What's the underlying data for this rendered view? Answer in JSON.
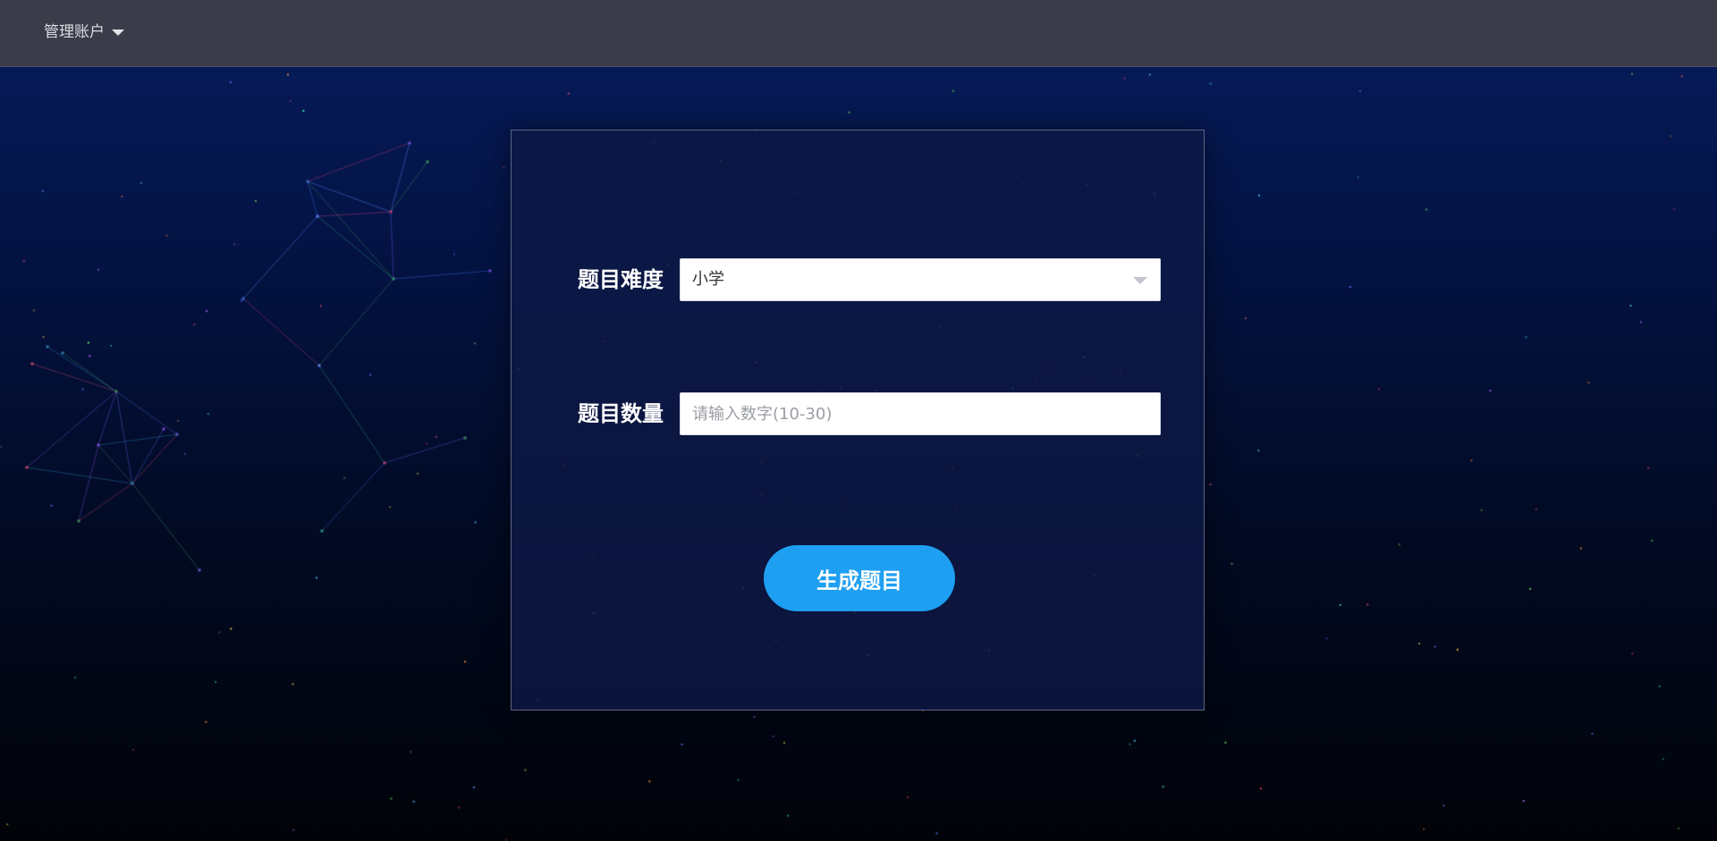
{
  "header": {
    "account_menu_label": "管理账户",
    "account_menu_icon": "caret-down-icon"
  },
  "form": {
    "difficulty": {
      "label": "题目难度",
      "selected_value": "小学",
      "dropdown_icon": "caret-down-icon"
    },
    "count": {
      "label": "题目数量",
      "value": "",
      "placeholder": "请输入数字(10-30)"
    },
    "submit_label": "生成题目"
  },
  "colors": {
    "topbar": "#3a3d49",
    "background_top": "#061a57",
    "background_bottom": "#010308",
    "panel_border": "#5b6585",
    "button": "#1e9ff2"
  }
}
